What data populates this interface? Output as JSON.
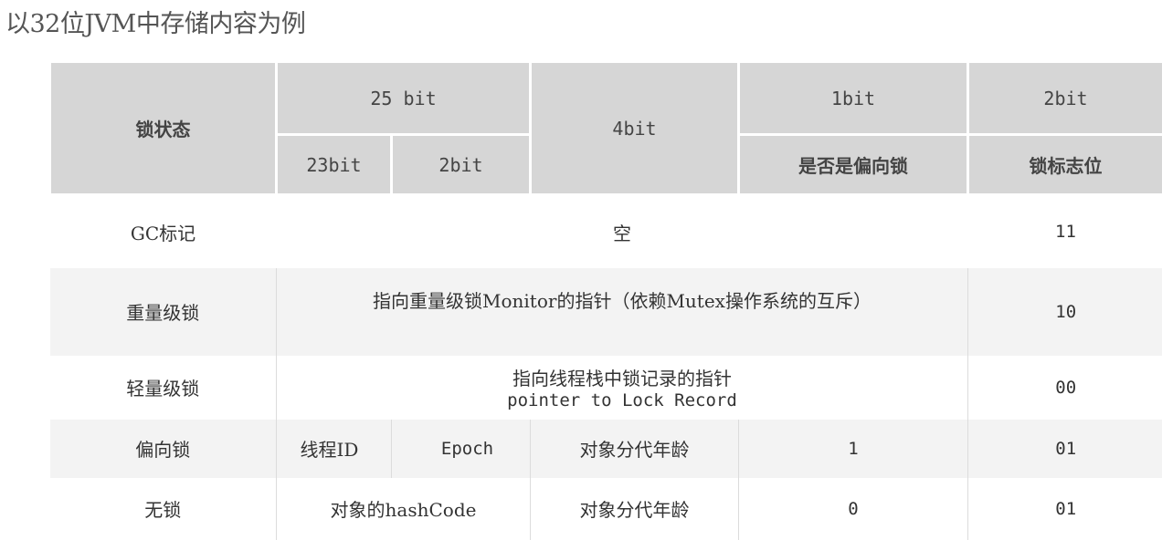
{
  "title": "以32位JVM中存储内容为例",
  "header": {
    "lock_state": "锁状态",
    "bits25": "25 bit",
    "bits23": "23bit",
    "bits2a": "2bit",
    "bits4": "4bit",
    "bits1": "1bit",
    "bits2b": "2bit",
    "biased_q": "是否是偏向锁",
    "lock_flag": "锁标志位"
  },
  "rows": [
    {
      "state": "GC标记",
      "content": "空",
      "flag": "11"
    },
    {
      "state": "重量级锁",
      "content": "指向重量级锁Monitor的指针（依赖Mutex操作系统的互斥）",
      "flag": "10"
    },
    {
      "state": "轻量级锁",
      "content_line1": "指向线程栈中锁记录的指针",
      "content_line2": "pointer to Lock Record",
      "flag": "00"
    },
    {
      "state": "偏向锁",
      "thread_id": "线程ID",
      "epoch": "Epoch",
      "age": "对象分代年龄",
      "biased": "1",
      "flag": "01"
    },
    {
      "state": "无锁",
      "hashcode": "对象的hashCode",
      "age": "对象分代年龄",
      "biased": "0",
      "flag": "01"
    }
  ]
}
